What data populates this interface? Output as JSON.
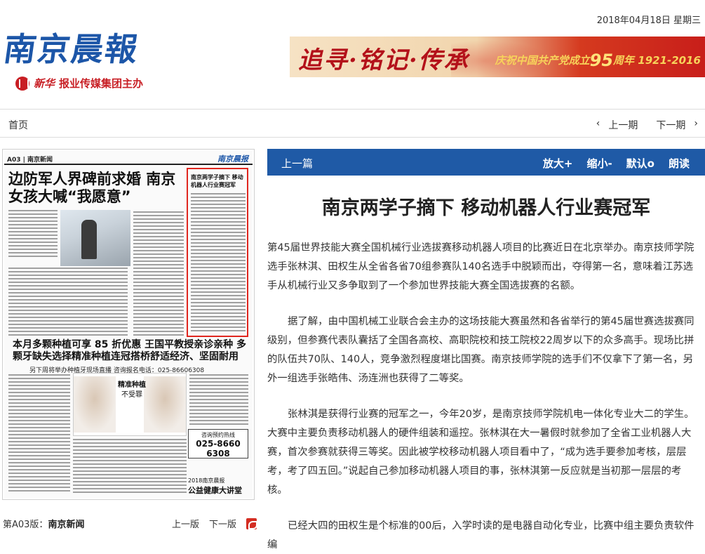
{
  "header": {
    "date": "2018年04月18日  星期三",
    "logo_text": "南京晨報",
    "sub_logo_brand": "新华",
    "sub_logo_text": "报业传媒集团主办",
    "banner": {
      "calligraphy": "追寻·铭记·传承",
      "slogan_prefix": "庆祝中国共产党成立",
      "slogan_number": "95",
      "slogan_suffix": "周年 1921-2016"
    }
  },
  "nav": {
    "home": "首页",
    "prev_issue": "上一期",
    "next_issue": "下一期"
  },
  "page_thumb": {
    "page_code": "A03 | 南京新闻",
    "masthead": "南京晨报",
    "headline": "边防军人界碑前求婚 南京女孩大喊“我愿意”",
    "box_title": "南京两学子摘下 移动机器人行业赛冠军",
    "ad_headline": "本月多颗种植可享 85 折优惠  王国平教授亲诊亲种 多颗牙缺失选择精准种植连冠搭桥舒适经济、坚固耐用",
    "ad_sub": "另下周将举办种植牙现场直播  咨询报名电话：025-86606308",
    "ad_mid_1": "精准种植",
    "ad_mid_2": "不受罪",
    "hotline_label": "咨询预约热线",
    "hotline_number": "025-8660 6308",
    "sponsor_small": "2018南京晨报",
    "sponsor": "公益健康大讲堂"
  },
  "page_footer": {
    "prefix": "第A03版：",
    "section": "南京新闻",
    "prev": "上一版",
    "next": "下一版"
  },
  "toolbar": {
    "prev_article": "上一篇",
    "zoom_in": "放大+",
    "zoom_out": "缩小-",
    "default": "默认o",
    "read_aloud": "朗读"
  },
  "article": {
    "title": "南京两学子摘下 移动机器人行业赛冠军",
    "paragraphs": [
      "第45届世界技能大赛全国机械行业选拔赛移动机器人项目的比赛近日在北京举办。南京技师学院选手张林淇、田权生从全省各省70组参赛队140名选手中脱颖而出，夺得第一名，意味着江苏选手从机械行业又多争取到了一个参加世界技能大赛全国选拔赛的名额。",
      "据了解，由中国机械工业联合会主办的这场技能大赛虽然和各省举行的第45届世赛选拔赛同级别，但参赛代表队囊括了全国各高校、高职院校和技工院校22周岁以下的众多高手。现场比拼的队伍共70队、140人，竞争激烈程度堪比国赛。南京技师学院的选手们不仅拿下了第一名，另外一组选手张皓伟、汤连洲也获得了二等奖。",
      "张林淇是获得行业赛的冠军之一，今年20岁，是南京技师学院机电一体化专业大二的学生。大赛中主要负责移动机器人的硬件组装和遥控。张林淇在大一暑假时就参加了全省工业机器人大赛，首次参赛就获得三等奖。因此被学校移动机器人项目看中了，“成为选手要参加考核，层层考，考了四五回。”说起自己参加移动机器人项目的事，张林淇第一反应就是当初那一层层的考核。",
      "已经大四的田权生是个标准的00后，入学时读的是电器自动化专业，比赛中组主要负责软件编"
    ]
  }
}
